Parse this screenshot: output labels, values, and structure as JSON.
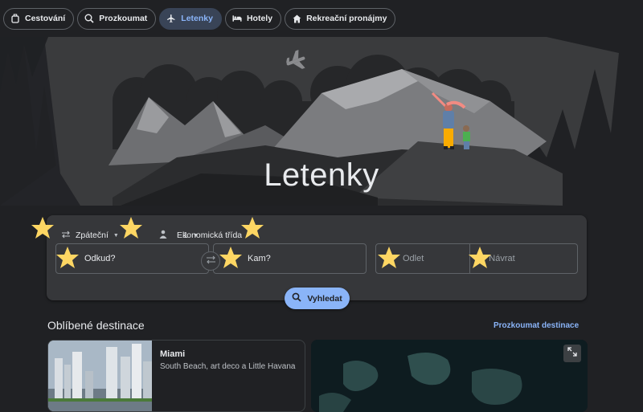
{
  "nav": {
    "items": [
      {
        "label": "Cestování",
        "icon": "suitcase-icon",
        "active": false
      },
      {
        "label": "Prozkoumat",
        "icon": "explore-icon",
        "active": false
      },
      {
        "label": "Letenky",
        "icon": "airplane-icon",
        "active": true
      },
      {
        "label": "Hotely",
        "icon": "bed-icon",
        "active": false
      },
      {
        "label": "Rekreační pronájmy",
        "icon": "home-icon",
        "active": false
      }
    ]
  },
  "hero": {
    "title": "Letenky"
  },
  "search": {
    "trip_type": "Zpáteční",
    "passengers": "1",
    "cabin_class": "Ekonomická třída",
    "from_placeholder": "Odkud?",
    "to_placeholder": "Kam?",
    "depart_placeholder": "Odlet",
    "return_placeholder": "Návrat",
    "button_label": "Vyhledat"
  },
  "popular": {
    "title": "Oblíbené destinace",
    "explore_link": "Prozkoumat destinace",
    "cards": [
      {
        "title": "Miami",
        "subtitle": "South Beach, art deco a Little Havana"
      }
    ]
  },
  "colors": {
    "accent": "#8ab4f8",
    "background": "#202124",
    "panel": "#36373a",
    "star": "#fdd663"
  }
}
